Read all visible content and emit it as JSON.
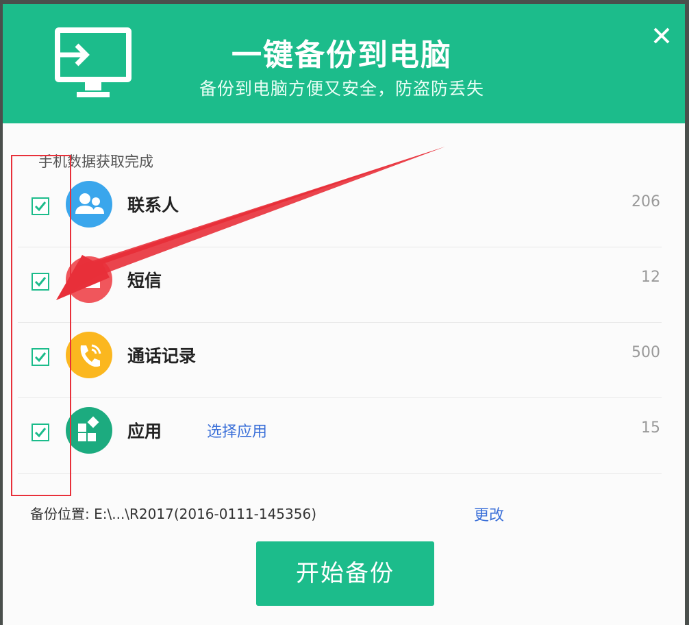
{
  "header": {
    "title": "一键备份到电脑",
    "subtitle": "备份到电脑方便又安全，防盗防丢失",
    "icon": "monitor-import-icon",
    "close_icon": "close-icon"
  },
  "status_text": "手机数据获取完成",
  "items": [
    {
      "label": "联系人",
      "count": "206",
      "icon": "contacts-icon",
      "color": "#3aa6ec",
      "checked": true
    },
    {
      "label": "短信",
      "count": "12",
      "icon": "sms-icon",
      "color": "#f0565c",
      "checked": true
    },
    {
      "label": "通话记录",
      "count": "500",
      "icon": "call-log-icon",
      "color": "#fbb71f",
      "checked": true
    },
    {
      "label": "应用",
      "count": "15",
      "icon": "apps-icon",
      "color": "#1cab7f",
      "checked": true,
      "link": "选择应用"
    }
  ],
  "backup_location": {
    "label": "备份位置:",
    "path": "E:\\...\\R2017(2016-0111-145356)",
    "change_link": "更改"
  },
  "start_button": "开始备份",
  "colors": {
    "primary": "#1cbc8b",
    "link": "#3a6fd8",
    "annotation": "#e8303a"
  }
}
